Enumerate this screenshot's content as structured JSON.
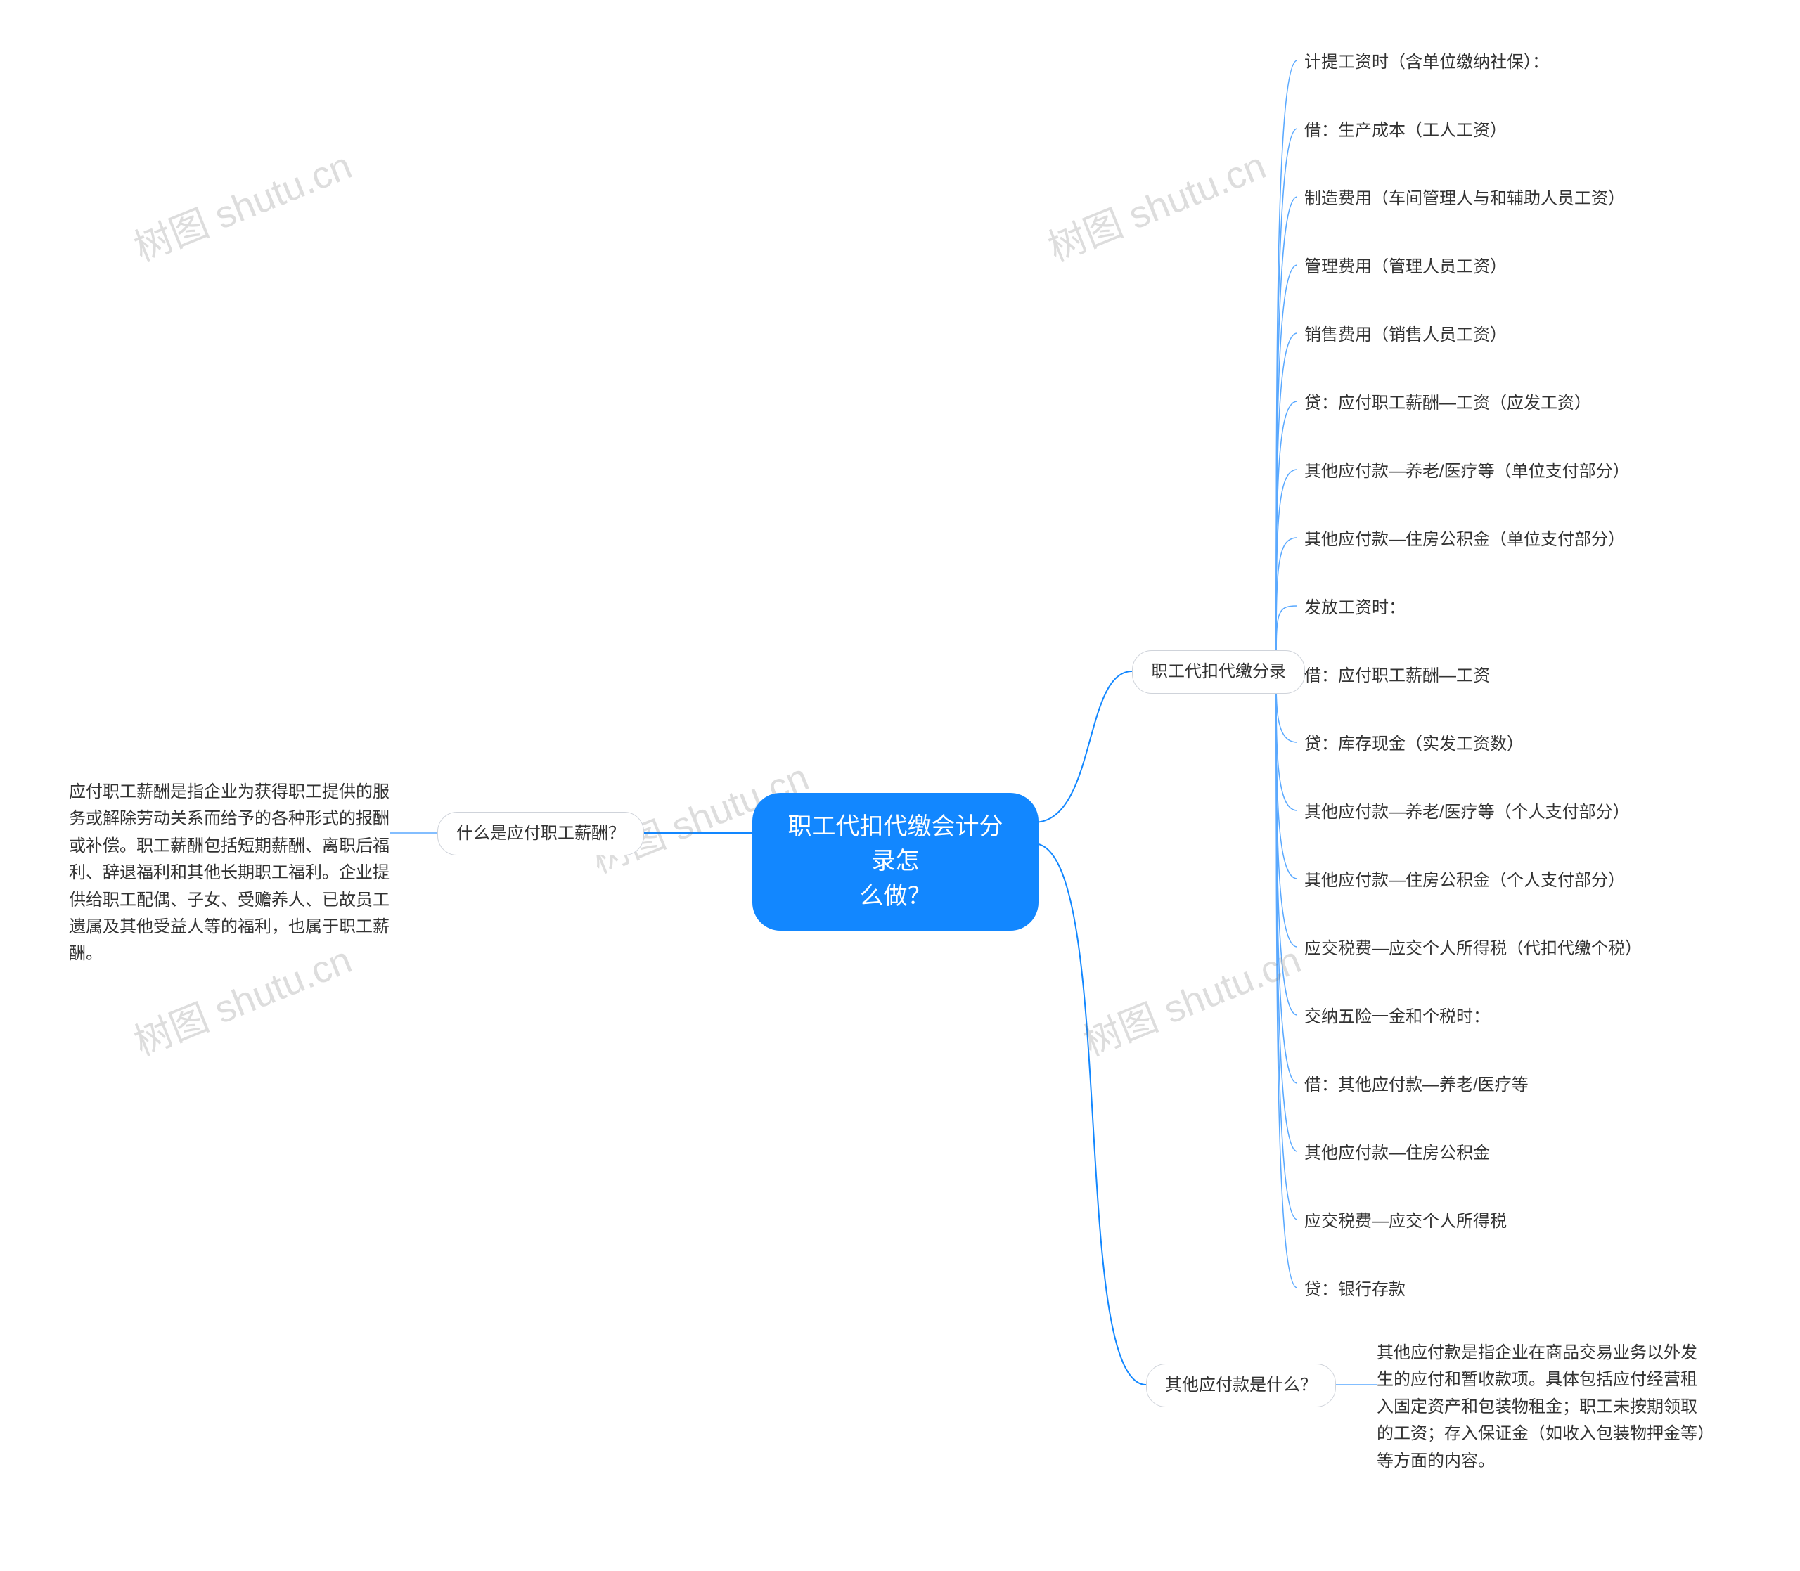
{
  "root": {
    "title_line1": "职工代扣代缴会计分录怎",
    "title_line2": "么做？"
  },
  "watermark": "树图 shutu.cn",
  "left_branch": {
    "label": "什么是应付职工薪酬？",
    "paragraph": "应付职工薪酬是指企业为获得职工提供的服务或解除劳动关系而给予的各种形式的报酬或补偿。职工薪酬包括短期薪酬、离职后福利、辞退福利和其他长期职工福利。企业提供给职工配偶、子女、受赡养人、已故员工遗属及其他受益人等的福利，也属于职工薪酬。"
  },
  "right_top": {
    "label": "职工代扣代缴分录",
    "items": [
      "计提工资时（含单位缴纳社保）：",
      "借：生产成本（工人工资）",
      "制造费用（车间管理人与和辅助人员工资）",
      "管理费用（管理人员工资）",
      "销售费用（销售人员工资）",
      "贷：应付职工薪酬—工资（应发工资）",
      "其他应付款—养老/医疗等（单位支付部分）",
      "其他应付款—住房公积金（单位支付部分）",
      "发放工资时：",
      "借：应付职工薪酬—工资",
      "贷：库存现金（实发工资数）",
      "其他应付款—养老/医疗等（个人支付部分）",
      "其他应付款—住房公积金（个人支付部分）",
      "应交税费—应交个人所得税（代扣代缴个税）",
      "交纳五险一金和个税时：",
      "借：其他应付款—养老/医疗等",
      "其他应付款—住房公积金",
      "应交税费—应交个人所得税",
      "贷：银行存款"
    ]
  },
  "right_bottom": {
    "label": "其他应付款是什么？",
    "paragraph": "其他应付款是指企业在商品交易业务以外发生的应付和暂收款项。具体包括应付经营租入固定资产和包装物租金；职工未按期领取的工资；存入保证金（如收入包装物押金等）等方面的内容。"
  },
  "chart_data": {
    "type": "mindmap",
    "root": "职工代扣代缴会计分录怎么做？",
    "branches": [
      {
        "side": "left",
        "label": "什么是应付职工薪酬？",
        "children": [
          "应付职工薪酬是指企业为获得职工提供的服务或解除劳动关系而给予的各种形式的报酬或补偿。职工薪酬包括短期薪酬、离职后福利、辞退福利和其他长期职工福利。企业提供给职工配偶、子女、受赡养人、已故员工遗属及其他受益人等的福利，也属于职工薪酬。"
        ]
      },
      {
        "side": "right",
        "label": "职工代扣代缴分录",
        "children": [
          "计提工资时（含单位缴纳社保）：",
          "借：生产成本（工人工资）",
          "制造费用（车间管理人与和辅助人员工资）",
          "管理费用（管理人员工资）",
          "销售费用（销售人员工资）",
          "贷：应付职工薪酬—工资（应发工资）",
          "其他应付款—养老/医疗等（单位支付部分）",
          "其他应付款—住房公积金（单位支付部分）",
          "发放工资时：",
          "借：应付职工薪酬—工资",
          "贷：库存现金（实发工资数）",
          "其他应付款—养老/医疗等（个人支付部分）",
          "其他应付款—住房公积金（个人支付部分）",
          "应交税费—应交个人所得税（代扣代缴个税）",
          "交纳五险一金和个税时：",
          "借：其他应付款—养老/医疗等",
          "其他应付款—住房公积金",
          "应交税费—应交个人所得税",
          "贷：银行存款"
        ]
      },
      {
        "side": "right",
        "label": "其他应付款是什么？",
        "children": [
          "其他应付款是指企业在商品交易业务以外发生的应付和暂收款项。具体包括应付经营租入固定资产和包装物租金；职工未按期领取的工资；存入保证金（如收入包装物押金等）等方面的内容。"
        ]
      }
    ]
  }
}
